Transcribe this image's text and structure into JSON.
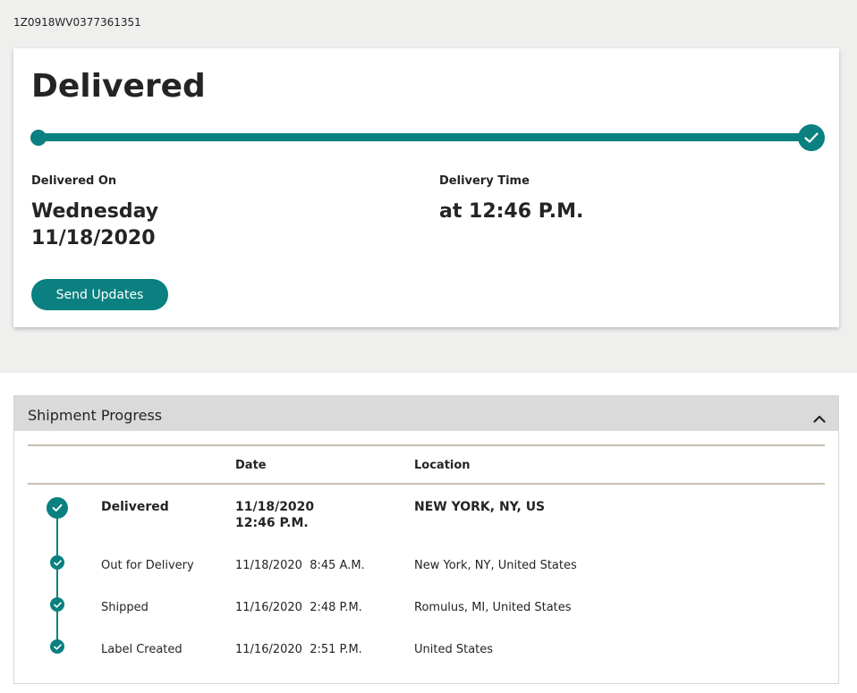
{
  "tracking_number": "1Z0918WV0377361351",
  "colors": {
    "accent": "#0a8080",
    "band": "#efefee",
    "header": "#dadada",
    "rule": "#c8bfb3"
  },
  "status": {
    "title": "Delivered",
    "progress_percent": 100,
    "delivered_on_label": "Delivered On",
    "delivered_on_day": "Wednesday",
    "delivered_on_date": "11/18/2020",
    "delivery_time_label": "Delivery Time",
    "delivery_time_value": "at 12:46 P.M.",
    "send_updates_label": "Send Updates"
  },
  "shipment_progress": {
    "title": "Shipment Progress",
    "columns": {
      "date": "Date",
      "location": "Location"
    },
    "rows": [
      {
        "status": "Delivered",
        "date": "11/18/2020",
        "time": "12:46 P.M.",
        "location": "NEW YORK, NY, US"
      },
      {
        "status": "Out for Delivery",
        "date": "11/18/2020  8:45 A.M.",
        "location": "New York, NY, United States"
      },
      {
        "status": "Shipped",
        "date": "11/16/2020  2:48 P.M.",
        "location": "Romulus, MI, United States"
      },
      {
        "status": "Label Created",
        "date": "11/16/2020  2:51 P.M.",
        "location": "United States"
      }
    ]
  }
}
